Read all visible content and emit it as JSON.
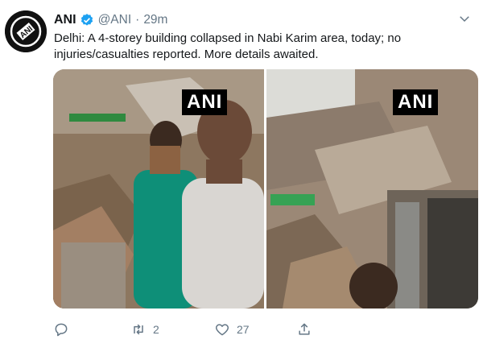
{
  "tweet": {
    "author": {
      "name": "ANI",
      "handle": "@ANI",
      "separator": "·",
      "time": "29m",
      "avatar_text": "ANI",
      "verified": true
    },
    "text": "Delhi: A 4-storey building collapsed in Nabi Karim area, today; no injuries/casualties reported. More details awaited.",
    "media": [
      {
        "watermark": "ANI"
      },
      {
        "watermark": "ANI"
      }
    ],
    "actions": {
      "reply": {
        "icon": "reply-icon",
        "count": ""
      },
      "retweet": {
        "icon": "retweet-icon",
        "count": "2"
      },
      "like": {
        "icon": "heart-icon",
        "count": "27"
      },
      "share": {
        "icon": "share-icon",
        "count": ""
      }
    }
  },
  "colors": {
    "text": "#14171a",
    "secondary": "#657786",
    "verified": "#1da1f2"
  }
}
